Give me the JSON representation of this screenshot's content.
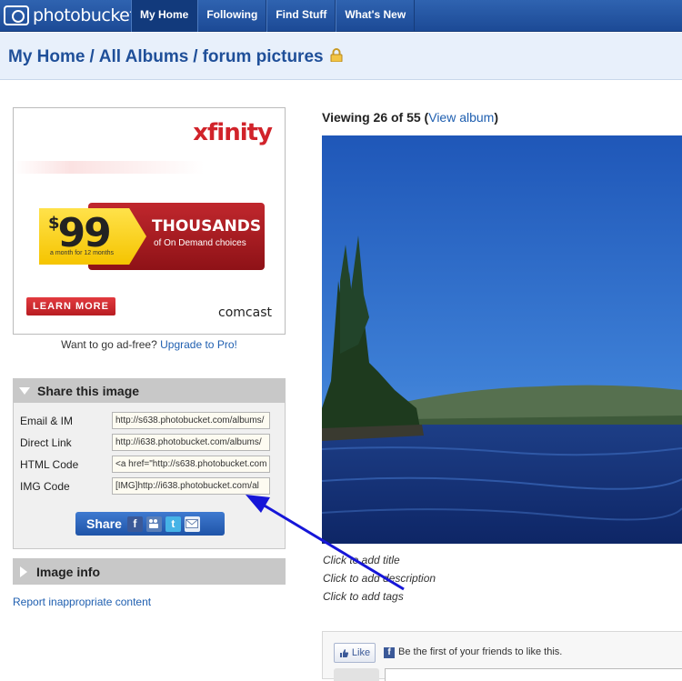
{
  "brand": {
    "logo_text": "photobucket"
  },
  "nav": {
    "tabs": [
      {
        "label": "My Home",
        "active": true
      },
      {
        "label": "Following",
        "active": false
      },
      {
        "label": "Find Stuff",
        "active": false
      },
      {
        "label": "What's New",
        "active": false
      }
    ]
  },
  "breadcrumb": {
    "items": [
      "My Home",
      "All Albums",
      "forum pictures"
    ],
    "separator": "/",
    "lock_icon": "lock-icon"
  },
  "ad": {
    "brand": "xfinity",
    "price_symbol": "$",
    "price": "99",
    "price_sub": "a month for 12 months",
    "headline": "THOUSANDS",
    "subline": "of On Demand choices",
    "cta": "LEARN MORE",
    "sponsor": "comcast",
    "adfree_text": "Want to go ad-free? ",
    "adfree_link": "Upgrade to Pro!"
  },
  "share": {
    "title": "Share this image",
    "rows": [
      {
        "label": "Email & IM",
        "value": "http://s638.photobucket.com/albums/"
      },
      {
        "label": "Direct Link",
        "value": "http://i638.photobucket.com/albums/"
      },
      {
        "label": "HTML Code",
        "value": "<a href=\"http://s638.photobucket.com"
      },
      {
        "label": "IMG Code",
        "value": "[IMG]http://i638.photobucket.com/al"
      }
    ],
    "share_button": "Share",
    "share_icons": [
      "facebook-icon",
      "myspace-icon",
      "twitter-icon",
      "email-icon"
    ]
  },
  "image_info": {
    "title": "Image info"
  },
  "report_link": "Report inappropriate content",
  "viewer": {
    "viewing_prefix": "Viewing 26 of 55 (",
    "view_album": "View album",
    "viewing_suffix": ")",
    "add_title": "Click to add title",
    "add_description": "Click to add description",
    "add_tags": "Click to add tags"
  },
  "social": {
    "like_label": "Like",
    "like_text": "Be the first of your friends to like this."
  },
  "colors": {
    "nav": "#2f63b0",
    "link": "#1f5fb0",
    "annotation_arrow": "#1616d8"
  }
}
